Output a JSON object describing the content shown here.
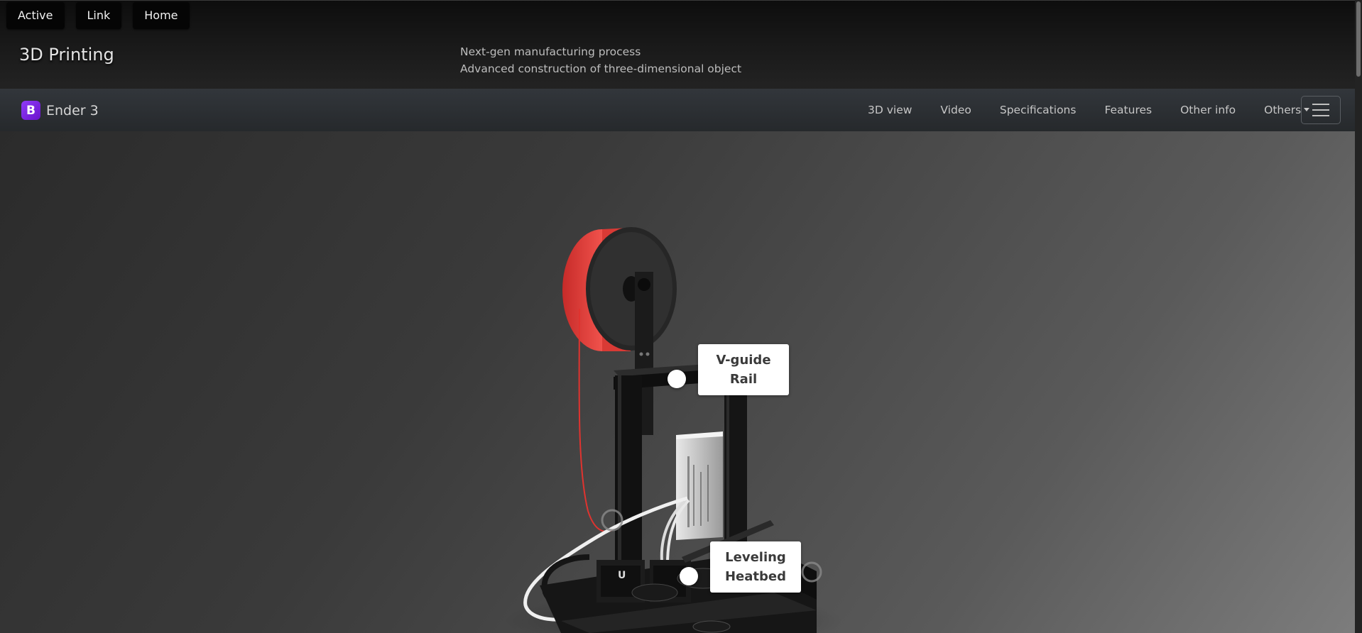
{
  "top_links": [
    {
      "label": "Active"
    },
    {
      "label": "Link"
    },
    {
      "label": "Home"
    }
  ],
  "header": {
    "title": "3D Printing",
    "tagline_1": "Next-gen manufacturing process",
    "tagline_2": "Advanced construction of three-dimensional object"
  },
  "navbar": {
    "brand_logo_letter": "B",
    "brand_name": "Ender 3",
    "items": [
      {
        "label": "3D view"
      },
      {
        "label": "Video"
      },
      {
        "label": "Specifications"
      },
      {
        "label": "Features"
      },
      {
        "label": "Other info"
      },
      {
        "label": "Others"
      }
    ],
    "toggler_icon": "hamburger-menu-icon"
  },
  "hotspots": [
    {
      "line_1": "V-guide",
      "line_2": "Rail"
    },
    {
      "line_1": "Leveling",
      "line_2": "Heatbed"
    }
  ],
  "colors": {
    "filament": "#e8403c",
    "brand_accent": "#7b2ff7",
    "frame": "#141414"
  }
}
